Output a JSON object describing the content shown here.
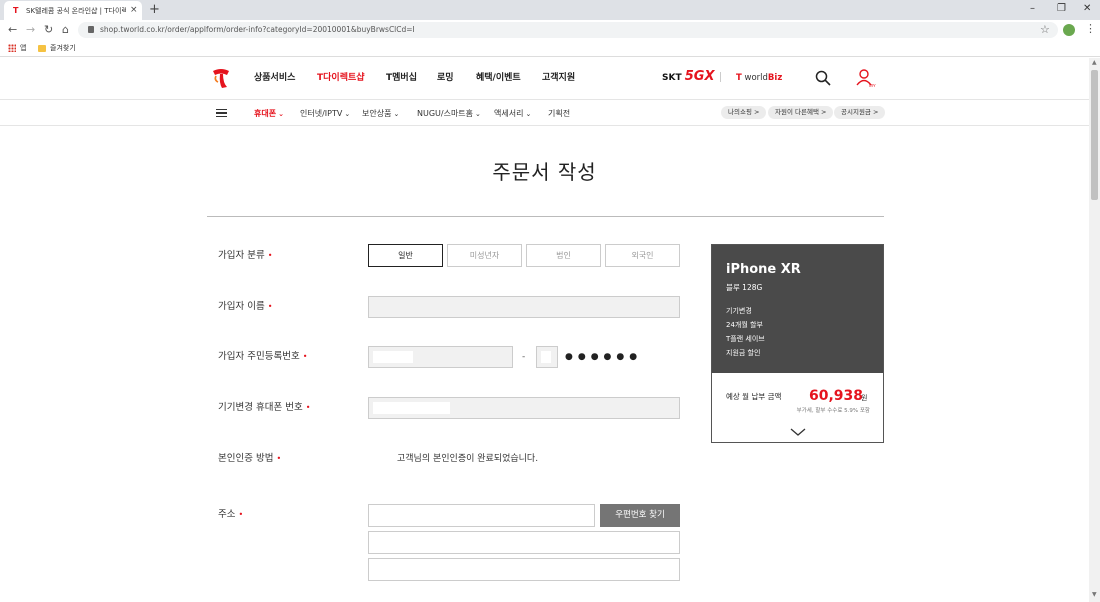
{
  "browser": {
    "tab_title": "SK텔레콤 공식 온라인샵 | T다이렉",
    "tab_close": "×",
    "new_tab": "+",
    "url": "shop.tworld.co.kr/order/applform/order-info?categoryId=20010001&buyBrwsClCd=I",
    "bookmarks": {
      "apps": "앱",
      "folder": "즐겨찾기"
    }
  },
  "gnb": {
    "items": [
      "상품서비스",
      "T다이렉트샵",
      "T멤버십",
      "로밍",
      "혜택/이벤트",
      "고객지원"
    ],
    "active_index": 1,
    "brand_5g_prefix": "SKT",
    "brand_5g_suffix": "5GX",
    "brand_world": "world",
    "brand_biz": "Biz",
    "user_icon_caption": "MY"
  },
  "lnb": {
    "items": [
      "휴대폰",
      "인터넷/IPTV",
      "보안상품",
      "NUGU/스마트홈",
      "액세서리",
      "기획전"
    ],
    "active_index": 0,
    "pills": [
      "나의쇼핑 >",
      "자원이 다른혜택 >",
      "공시지원금 >"
    ]
  },
  "page_title": "주문서 작성",
  "form": {
    "subscriber_type": {
      "label": "가입자 분류",
      "options": [
        "일반",
        "미성년자",
        "법인",
        "외국인"
      ],
      "selected_index": 0
    },
    "name": {
      "label": "가입자 이름",
      "value": ""
    },
    "resident_id": {
      "label": "가입자 주민등록번호",
      "dash": "-",
      "masked": "●●●●●●"
    },
    "phone": {
      "label": "기기변경 휴대폰 번호"
    },
    "auth": {
      "label": "본인인증 방법",
      "status": "고객님의 본인인증이 완료되었습니다."
    },
    "address": {
      "label": "주소",
      "zip_button": "우편번호 찾기"
    },
    "required_mark": "•"
  },
  "summary": {
    "model": "iPhone XR",
    "option": "블루  128G",
    "details": [
      "기기변경",
      "24개월 할부",
      "T플랜 세이브",
      "지원금 할인"
    ],
    "pay_label": "예상 월 납부 금액",
    "pay_amount": "60,938",
    "pay_unit": "원",
    "pay_note": "부가세, 할부 수수료 5.9% 포함"
  },
  "colors": {
    "accent": "#e5141e",
    "summary_bg": "#4a4a4a",
    "zip_button": "#757575"
  }
}
